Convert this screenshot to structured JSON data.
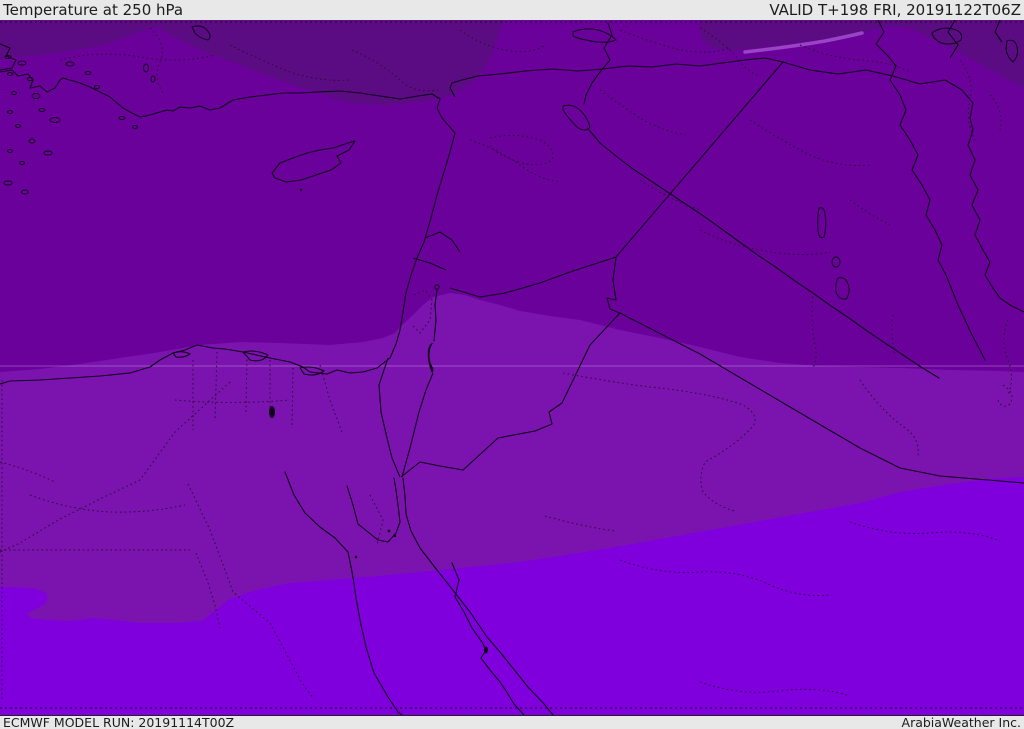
{
  "header": {
    "title": "Temperature at 250 hPa",
    "valid": "VALID T+198 FRI, 20191122T06Z"
  },
  "footer": {
    "model_run": "ECMWF MODEL RUN: 20191114T00Z",
    "brand": "ArabiaWeather Inc."
  },
  "map": {
    "colors": {
      "cold_overlay": "#5C0C83",
      "cold": "#6B019B",
      "mild": "#7B14AE",
      "warm": "#7F00DC",
      "anomaly_sliver": "#A050CC",
      "latitude_line": "#D9B3F2",
      "coastline": "#10011B",
      "admin_dotted": "#2B0B36",
      "bar_background": "#E8E8E8",
      "bar_text": "#1C1C1C"
    }
  }
}
